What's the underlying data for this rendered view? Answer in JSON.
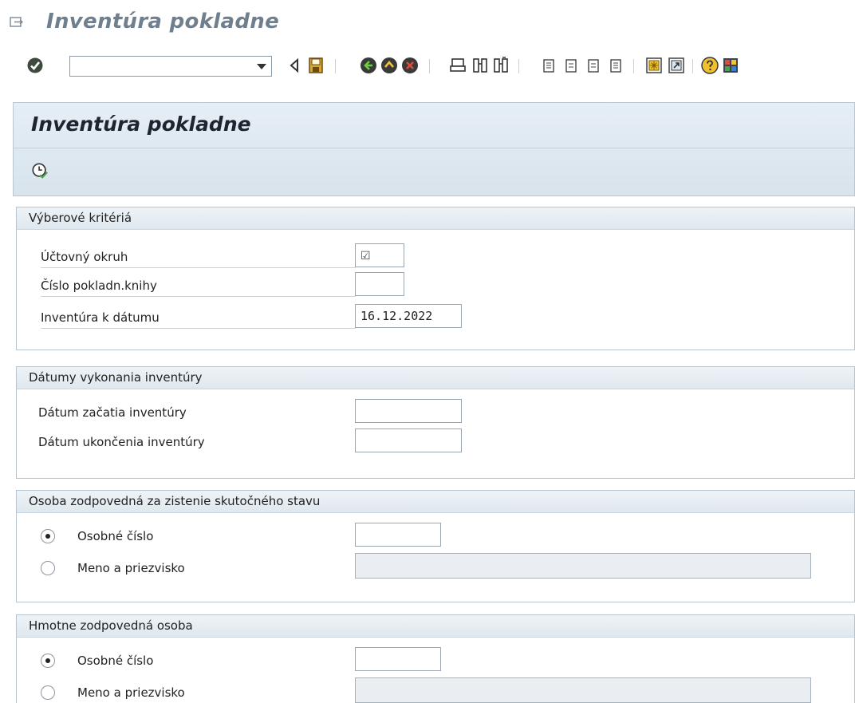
{
  "window": {
    "title": "Inventúra pokladne"
  },
  "toolbar": {
    "command_field_value": "",
    "icons": [
      "enter-icon",
      "back-small-icon",
      "save-icon",
      "back-icon",
      "exit-icon",
      "cancel-icon",
      "print-icon",
      "find-icon",
      "find-next-icon",
      "first-page-icon",
      "previous-page-icon",
      "next-page-icon",
      "last-page-icon",
      "new-session-icon",
      "shortcut-icon",
      "help-icon",
      "layout-icon"
    ]
  },
  "screen": {
    "title": "Inventúra pokladne",
    "execute_icon": "execute-clock-icon"
  },
  "groups": {
    "selection": {
      "title": "Výberové kritériá",
      "company_code_label": "Účtovný okruh",
      "company_code_value": "☑",
      "cash_journal_label": "Číslo pokladn.knihy",
      "cash_journal_value": "",
      "inventory_date_label": "Inventúra k dátumu",
      "inventory_date_value": "16.12.2022"
    },
    "dates": {
      "title": "Dátumy vykonania inventúry",
      "start_label": "Dátum začatia inventúry",
      "start_value": "",
      "end_label": "Dátum ukončenia inventúry",
      "end_value": ""
    },
    "responsible_actual": {
      "title": "Osoba zodpovedná za zistenie skutočného stavu",
      "personnel_label": "Osobné číslo",
      "personnel_value": "",
      "name_label": "Meno a priezvisko",
      "name_value": "",
      "selected": "personnel"
    },
    "liable": {
      "title": "Hmotne zodpovedná osoba",
      "personnel_label": "Osobné číslo",
      "personnel_value": "",
      "name_label": "Meno a priezvisko",
      "name_value": "",
      "selected": "personnel"
    }
  }
}
